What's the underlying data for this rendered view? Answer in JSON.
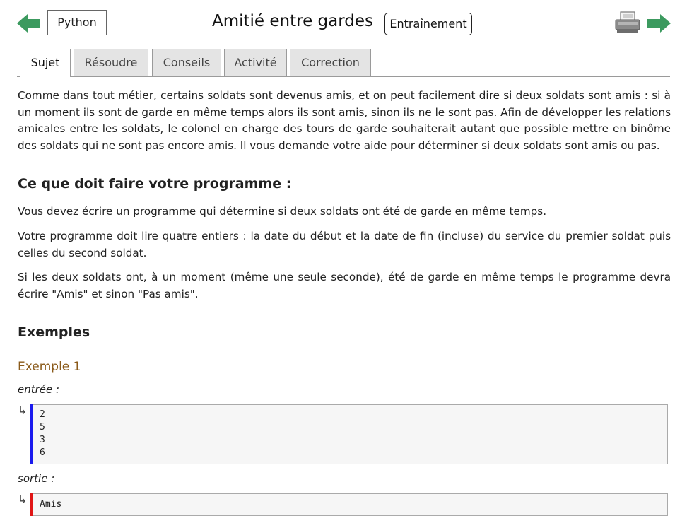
{
  "header": {
    "language_button": "Python",
    "title": "Amitié entre gardes",
    "badge": "Entraînement",
    "icons": {
      "prev": "left-arrow-icon",
      "next": "right-arrow-icon",
      "print": "printer-icon"
    },
    "colors": {
      "arrow": "#3c9a5f",
      "accent_example": "#8a5a1a",
      "input_bar": "#1a1aee",
      "output_bar": "#e01515"
    }
  },
  "tabs": [
    {
      "label": "Sujet",
      "active": true
    },
    {
      "label": "Résoudre",
      "active": false
    },
    {
      "label": "Conseils",
      "active": false
    },
    {
      "label": "Activité",
      "active": false
    },
    {
      "label": "Correction",
      "active": false
    }
  ],
  "content": {
    "intro": "Comme dans tout métier, certains soldats sont devenus amis, et on peut facilement dire si deux soldats sont amis : si à un moment ils sont de garde en même temps alors ils sont amis, sinon ils ne le sont pas. Afin de développer les relations amicales entre les soldats, le colonel en charge des tours de garde souhaiterait autant que possible mettre en binôme des soldats qui ne sont pas encore amis. Il vous demande votre aide pour déterminer si deux soldats sont amis ou pas.",
    "section_heading": "Ce que doit faire votre programme :",
    "paragraphs": [
      "Vous devez écrire un programme qui détermine si deux soldats ont été de garde en même temps.",
      "Votre programme doit lire quatre entiers : la date du début et la date de fin (incluse) du service du premier soldat puis celles du second soldat.",
      "Si les deux soldats ont, à un moment (même une seule seconde), été de garde en même temps le programme devra écrire \"Amis\" et sinon \"Pas amis\"."
    ],
    "examples_heading": "Exemples",
    "example": {
      "title": "Exemple 1",
      "input_label": "entrée :",
      "input_lines": [
        "2",
        "5",
        "3",
        "6"
      ],
      "output_label": "sortie :",
      "output_lines": [
        "Amis"
      ],
      "arrow_glyph": "↳"
    }
  }
}
